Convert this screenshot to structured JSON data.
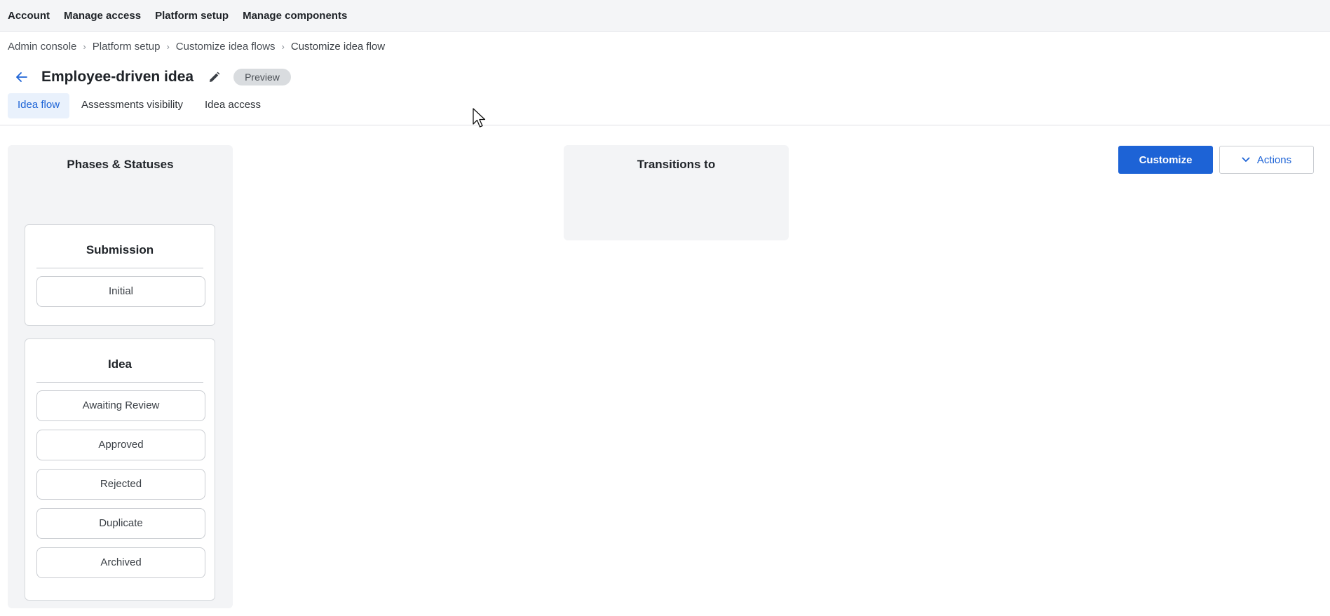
{
  "topnav": {
    "items": [
      {
        "label": "Account"
      },
      {
        "label": "Manage access"
      },
      {
        "label": "Platform setup"
      },
      {
        "label": "Manage components"
      }
    ]
  },
  "breadcrumb": {
    "items": [
      {
        "label": "Admin console"
      },
      {
        "label": "Platform setup"
      },
      {
        "label": "Customize idea flows"
      }
    ],
    "current": "Customize idea flow"
  },
  "header": {
    "title": "Employee-driven idea",
    "badge": "Preview"
  },
  "tabs": [
    {
      "label": "Idea flow",
      "active": true
    },
    {
      "label": "Assessments visibility",
      "active": false
    },
    {
      "label": "Idea access",
      "active": false
    }
  ],
  "phases_panel": {
    "title": "Phases & Statuses",
    "phases": [
      {
        "name": "Submission",
        "statuses": [
          "Initial"
        ]
      },
      {
        "name": "Idea",
        "statuses": [
          "Awaiting Review",
          "Approved",
          "Rejected",
          "Duplicate",
          "Archived"
        ]
      }
    ]
  },
  "transitions_panel": {
    "title": "Transitions to"
  },
  "actions": {
    "customize_label": "Customize",
    "actions_label": "Actions"
  },
  "colors": {
    "accent": "#1d63d6",
    "active_tab_bg": "#e9f1fc",
    "panel_bg": "#f3f4f6"
  }
}
